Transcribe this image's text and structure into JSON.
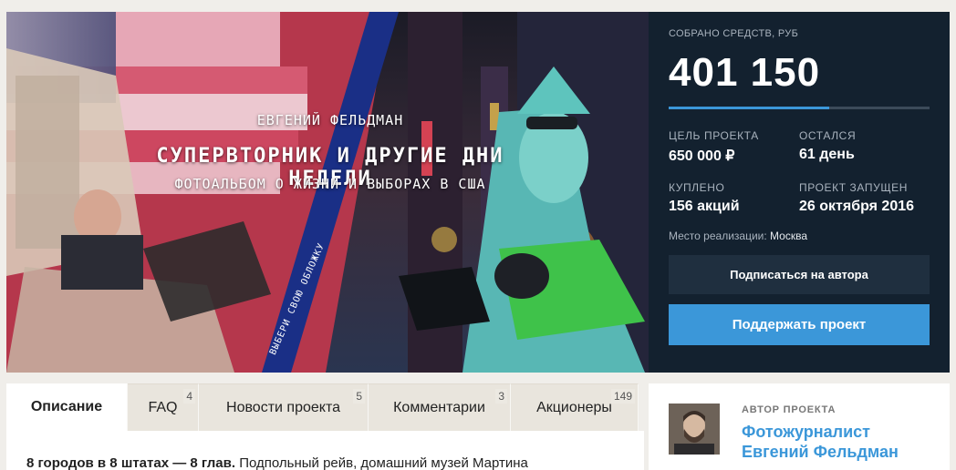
{
  "hero": {
    "author": "ЕВГЕНИЙ ФЕЛЬДМАН",
    "title": "СУПЕРВТОРНИК И ДРУГИЕ ДНИ НЕДЕЛИ",
    "subtitle": "ФОТОАЛЬБОМ О ЖИЗНИ И ВЫБОРАХ В США",
    "stripe_text": "ВЫБЕРИ СВОЮ ОБЛОЖКУ",
    "stripe_color": "#1a2f86"
  },
  "funding": {
    "raised_label": "СОБРАНО СРЕДСТВ, РУБ",
    "raised_value": "401 150",
    "progress_fraction": 0.617,
    "goal_label": "ЦЕЛЬ ПРОЕКТА",
    "goal_value": "650 000 ₽",
    "left_label": "ОСТАЛСЯ",
    "left_value": "61 день",
    "bought_label": "КУПЛЕНО",
    "bought_value": "156 акций",
    "started_label": "ПРОЕКТ ЗАПУЩЕН",
    "started_value": "26 октября 2016",
    "place_label": "Место реализации:",
    "place_value": "Москва",
    "subscribe_label": "Подписаться на автора",
    "support_label": "Поддержать проект",
    "accent_color": "#3b97d9",
    "panel_color": "#13212f"
  },
  "tabs": [
    {
      "label": "Описание",
      "count": ""
    },
    {
      "label": "FAQ",
      "count": "4"
    },
    {
      "label": "Новости проекта",
      "count": "5"
    },
    {
      "label": "Комментарии",
      "count": "3"
    },
    {
      "label": "Акционеры",
      "count": "149"
    }
  ],
  "description": {
    "lead": "8 городов в 8 штатах — 8 глав.",
    "text": "Подпольный рейв, домашний музей Мартина"
  },
  "author_card": {
    "label": "АВТОР ПРОЕКТА",
    "name_line1": "Фотожурналист",
    "name_line2": "Евгений Фельдман"
  }
}
